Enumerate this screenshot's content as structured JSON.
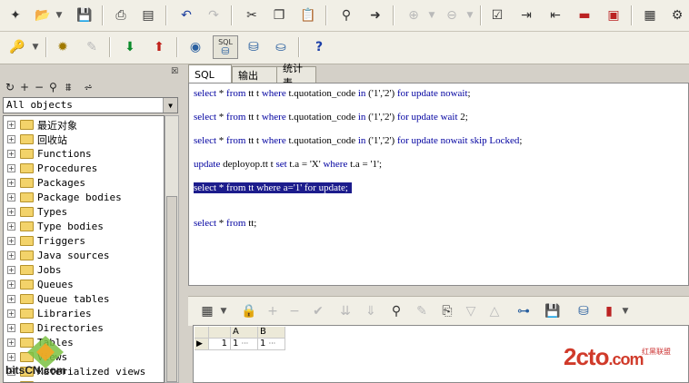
{
  "toolbar1": {
    "icons": [
      "new-icon",
      "open-icon",
      "save-icon",
      "print-icon",
      "print-preview-icon",
      "undo-icon",
      "redo-icon",
      "cut-icon",
      "copy-icon",
      "paste-icon",
      "find-icon",
      "find-next-icon",
      "uncomment-icon",
      "comment-icon",
      "execute-window-icon",
      "indent-icon",
      "unindent-icon",
      "upper-case-icon",
      "lower-case-icon",
      "window-list-icon"
    ]
  },
  "toolbar2": {
    "icons": [
      "key-icon",
      "gear-icon",
      "break-icon",
      "commit-icon",
      "rollback-icon",
      "log-on-icon",
      "sql-window-icon",
      "command-window-icon",
      "explain-plan-icon",
      "help-icon"
    ],
    "sql_label": "SQL"
  },
  "object_browser": {
    "filter": "All objects",
    "items": [
      "最近对象",
      "回收站",
      "Functions",
      "Procedures",
      "Packages",
      "Package bodies",
      "Types",
      "Type bodies",
      "Triggers",
      "Java sources",
      "Jobs",
      "Queues",
      "Queue tables",
      "Libraries",
      "Directories",
      "Tables",
      "Views",
      "Materialized views",
      "Se"
    ]
  },
  "tabs": [
    "SQL",
    "输出",
    "统计表"
  ],
  "editor": {
    "lines": [
      {
        "tokens": [
          [
            "kw",
            "select"
          ],
          [
            "t",
            " * "
          ],
          [
            "kw",
            "from"
          ],
          [
            "t",
            " tt t "
          ],
          [
            "kw",
            "where"
          ],
          [
            "t",
            " t.quotation_code "
          ],
          [
            "kw",
            "in"
          ],
          [
            "t",
            " ('1','2') "
          ],
          [
            "kw",
            "for"
          ],
          [
            "t",
            " "
          ],
          [
            "kw",
            "update"
          ],
          [
            "t",
            " "
          ],
          [
            "kw",
            "nowait"
          ],
          [
            "t",
            ";"
          ]
        ]
      },
      {
        "tokens": [
          [
            "kw",
            "select"
          ],
          [
            "t",
            " * "
          ],
          [
            "kw",
            "from"
          ],
          [
            "t",
            " tt t "
          ],
          [
            "kw",
            "where"
          ],
          [
            "t",
            " t.quotation_code "
          ],
          [
            "kw",
            "in"
          ],
          [
            "t",
            " ('1','2') "
          ],
          [
            "kw",
            "for"
          ],
          [
            "t",
            " "
          ],
          [
            "kw",
            "update"
          ],
          [
            "t",
            " "
          ],
          [
            "kw",
            "wait"
          ],
          [
            "t",
            " 2;"
          ]
        ]
      },
      {
        "tokens": [
          [
            "kw",
            "select"
          ],
          [
            "t",
            " * "
          ],
          [
            "kw",
            "from"
          ],
          [
            "t",
            " tt t "
          ],
          [
            "kw",
            "where"
          ],
          [
            "t",
            " t.quotation_code "
          ],
          [
            "kw",
            "in"
          ],
          [
            "t",
            " ('1','2') "
          ],
          [
            "kw",
            "for"
          ],
          [
            "t",
            " "
          ],
          [
            "kw",
            "update"
          ],
          [
            "t",
            " "
          ],
          [
            "kw",
            "nowait"
          ],
          [
            "t",
            " "
          ],
          [
            "kw",
            "skip"
          ],
          [
            "t",
            " "
          ],
          [
            "kw",
            "Locked"
          ],
          [
            "t",
            ";"
          ]
        ]
      },
      {
        "tokens": [
          [
            "kw",
            "update"
          ],
          [
            "t",
            " deployop.tt t "
          ],
          [
            "kw",
            "set"
          ],
          [
            "t",
            " t.a = 'X' "
          ],
          [
            "kw",
            "where"
          ],
          [
            "t",
            " t.a = '1';"
          ]
        ]
      },
      {
        "tokens": [
          [
            "kw",
            "select"
          ],
          [
            "t",
            " * "
          ],
          [
            "kw",
            "from"
          ],
          [
            "t",
            " tt "
          ],
          [
            "kw",
            "where"
          ],
          [
            "t",
            " a='1' "
          ],
          [
            "kw",
            "for"
          ],
          [
            "t",
            " "
          ],
          [
            "kw",
            "update"
          ],
          [
            "t",
            ";"
          ]
        ],
        "selected": true
      },
      {
        "tokens": [
          [
            "kw",
            "select"
          ],
          [
            "t",
            " * "
          ],
          [
            "kw",
            "from"
          ],
          [
            "t",
            " tt;"
          ]
        ]
      }
    ]
  },
  "result_grid": {
    "columns": [
      "A",
      "B"
    ],
    "rows": [
      {
        "num": "1",
        "cells": [
          "1",
          "1"
        ]
      }
    ],
    "ellipsis": "···"
  },
  "watermarks": {
    "left": "bitsCN.com",
    "right": "2cto",
    "right_tld": ".com",
    "right_cn": "红黑联盟"
  }
}
